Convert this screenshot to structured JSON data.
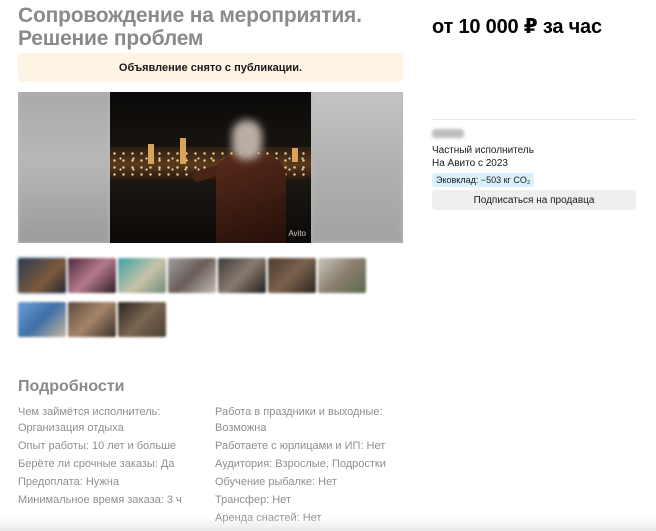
{
  "listing": {
    "title": "Сопровождение на мероприятия. Решение проблем",
    "price": "от 10 000 ₽ за час",
    "notice": "Объявление снято с публикации.",
    "watermark": "Avito"
  },
  "seller": {
    "type": "Частный исполнитель",
    "since": "На Авито с 2023",
    "eco_badge": "Эковклад: −503 кг CO₂",
    "subscribe_label": "Подписаться на продавца"
  },
  "details": {
    "heading": "Подробности",
    "left": [
      "Чем займётся исполнитель:",
      "Организация отдыха",
      "Опыт работы: 10 лет и больше",
      "Берёте ли срочные заказы: Да",
      "Предоплата: Нужна",
      "Минимальное время заказа: 3 ч"
    ],
    "right": [
      "Работа в праздники и выходные:",
      "Возможна",
      "Работаете с юрлицами и ИП: Нет",
      "Аудитория: Взрослые, Подростки",
      "Обучение рыбалке: Нет",
      "Трансфер: Нет",
      "Аренда снастей: Нет"
    ]
  },
  "colors": {
    "notice_bg": "#fdf4e6",
    "eco_badge_bg": "#d9f1fb",
    "button_bg": "#efefef",
    "muted_text": "#8a8a8a"
  }
}
